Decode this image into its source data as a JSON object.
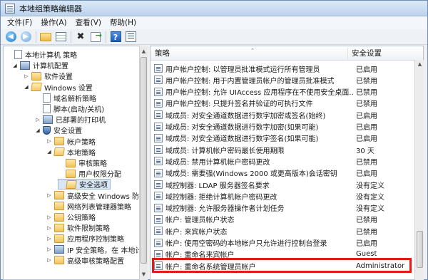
{
  "window": {
    "title": "本地组策略编辑器"
  },
  "menubar": [
    "文件(F)",
    "操作(A)",
    "查看(V)",
    "帮助(H)"
  ],
  "toolbar": {
    "icons": [
      "back-arrow-icon",
      "forward-arrow-icon",
      "folder-up-icon",
      "show-hide-tree-icon",
      "delete-icon",
      "export-list-icon",
      "help-icon",
      "properties-icon"
    ],
    "back_glyph": "◀",
    "forward_glyph": "▶",
    "delete_glyph": "✖",
    "help_glyph": "?"
  },
  "tree": [
    {
      "label": "本地计算机 策略",
      "icon": "computer-policy-icon",
      "expander": ""
    },
    {
      "label": "计算机配置",
      "icon": "computer-icon",
      "expander": "◢"
    },
    {
      "label": "软件设置",
      "icon": "folder-icon",
      "expander": "▷"
    },
    {
      "label": "Windows 设置",
      "icon": "folder-open-icon",
      "expander": "◢"
    },
    {
      "label": "域名解析策略",
      "icon": "document-icon",
      "expander": ""
    },
    {
      "label": "脚本(启动/关机)",
      "icon": "document-icon",
      "expander": ""
    },
    {
      "label": "已部署的打印机",
      "icon": "printer-icon",
      "expander": "▷"
    },
    {
      "label": "安全设置",
      "icon": "shield-icon",
      "expander": "◢"
    },
    {
      "label": "帐户策略",
      "icon": "folder-icon",
      "expander": "▷"
    },
    {
      "label": "本地策略",
      "icon": "folder-open-icon",
      "expander": "◢"
    },
    {
      "label": "审核策略",
      "icon": "folder-icon",
      "expander": ""
    },
    {
      "label": "用户权限分配",
      "icon": "folder-icon",
      "expander": ""
    },
    {
      "label": "安全选项",
      "icon": "folder-open-icon",
      "expander": "",
      "selected": true
    },
    {
      "label": "高级安全 Windows 防火墙",
      "icon": "folder-icon",
      "expander": "▷"
    },
    {
      "label": "网络列表管理器策略",
      "icon": "folder-icon",
      "expander": ""
    },
    {
      "label": "公钥策略",
      "icon": "folder-icon",
      "expander": "▷"
    },
    {
      "label": "软件限制策略",
      "icon": "folder-icon",
      "expander": "▷"
    },
    {
      "label": "应用程序控制策略",
      "icon": "folder-icon",
      "expander": "▷"
    },
    {
      "label": "IP 安全策略，在 本地计算",
      "icon": "ip-security-icon",
      "expander": "▷"
    },
    {
      "label": "高级审核策略配置",
      "icon": "folder-icon",
      "expander": "▷"
    }
  ],
  "list": {
    "col_policy": "策略",
    "col_setting": "安全设置",
    "rows": [
      {
        "policy": "用户帐户控制: 以管理员批准模式运行所有管理员",
        "setting": "已启用"
      },
      {
        "policy": "用户帐户控制: 用于内置管理员帐户的管理员批准模式",
        "setting": "已禁用"
      },
      {
        "policy": "用户帐户控制: 允许 UIAccess 应用程序在不使用安全桌面...",
        "setting": "已禁用"
      },
      {
        "policy": "用户帐户控制: 只提升签名并验证的可执行文件",
        "setting": "已禁用"
      },
      {
        "policy": "域成员: 对安全通道数据进行数字加密或签名(始终)",
        "setting": "已启用"
      },
      {
        "policy": "域成员: 对安全通道数据进行数字加密(如果可能)",
        "setting": "已启用"
      },
      {
        "policy": "域成员: 对安全通道数据进行数字签名(如果可能)",
        "setting": "已启用"
      },
      {
        "policy": "域成员: 计算机帐户密码最长使用期限",
        "setting": "30 天"
      },
      {
        "policy": "域成员: 禁用计算机帐户密码更改",
        "setting": "已禁用"
      },
      {
        "policy": "域成员: 需要强(Windows 2000 或更高版本)会话密钥",
        "setting": "已启用"
      },
      {
        "policy": "域控制器: LDAP 服务器签名要求",
        "setting": "没有定义"
      },
      {
        "policy": "域控制器: 拒绝计算机帐户密码更改",
        "setting": "没有定义"
      },
      {
        "policy": "域控制器: 允许服务器操作者计划任务",
        "setting": "没有定义"
      },
      {
        "policy": "帐户: 管理员帐户状态",
        "setting": "已禁用"
      },
      {
        "policy": "帐户: 来宾帐户状态",
        "setting": "已禁用"
      },
      {
        "policy": "帐户: 使用空密码的本地帐户只允许进行控制台登录",
        "setting": "已启用"
      },
      {
        "policy": "帐户: 重命名来宾帐户",
        "setting": "Guest"
      },
      {
        "policy": "帐户: 重命名系统管理员帐户",
        "setting": "Administrator",
        "highlighted": true
      }
    ]
  },
  "colors": {
    "highlight_box": "#e41a1a",
    "selection": "#d8e6f7"
  }
}
